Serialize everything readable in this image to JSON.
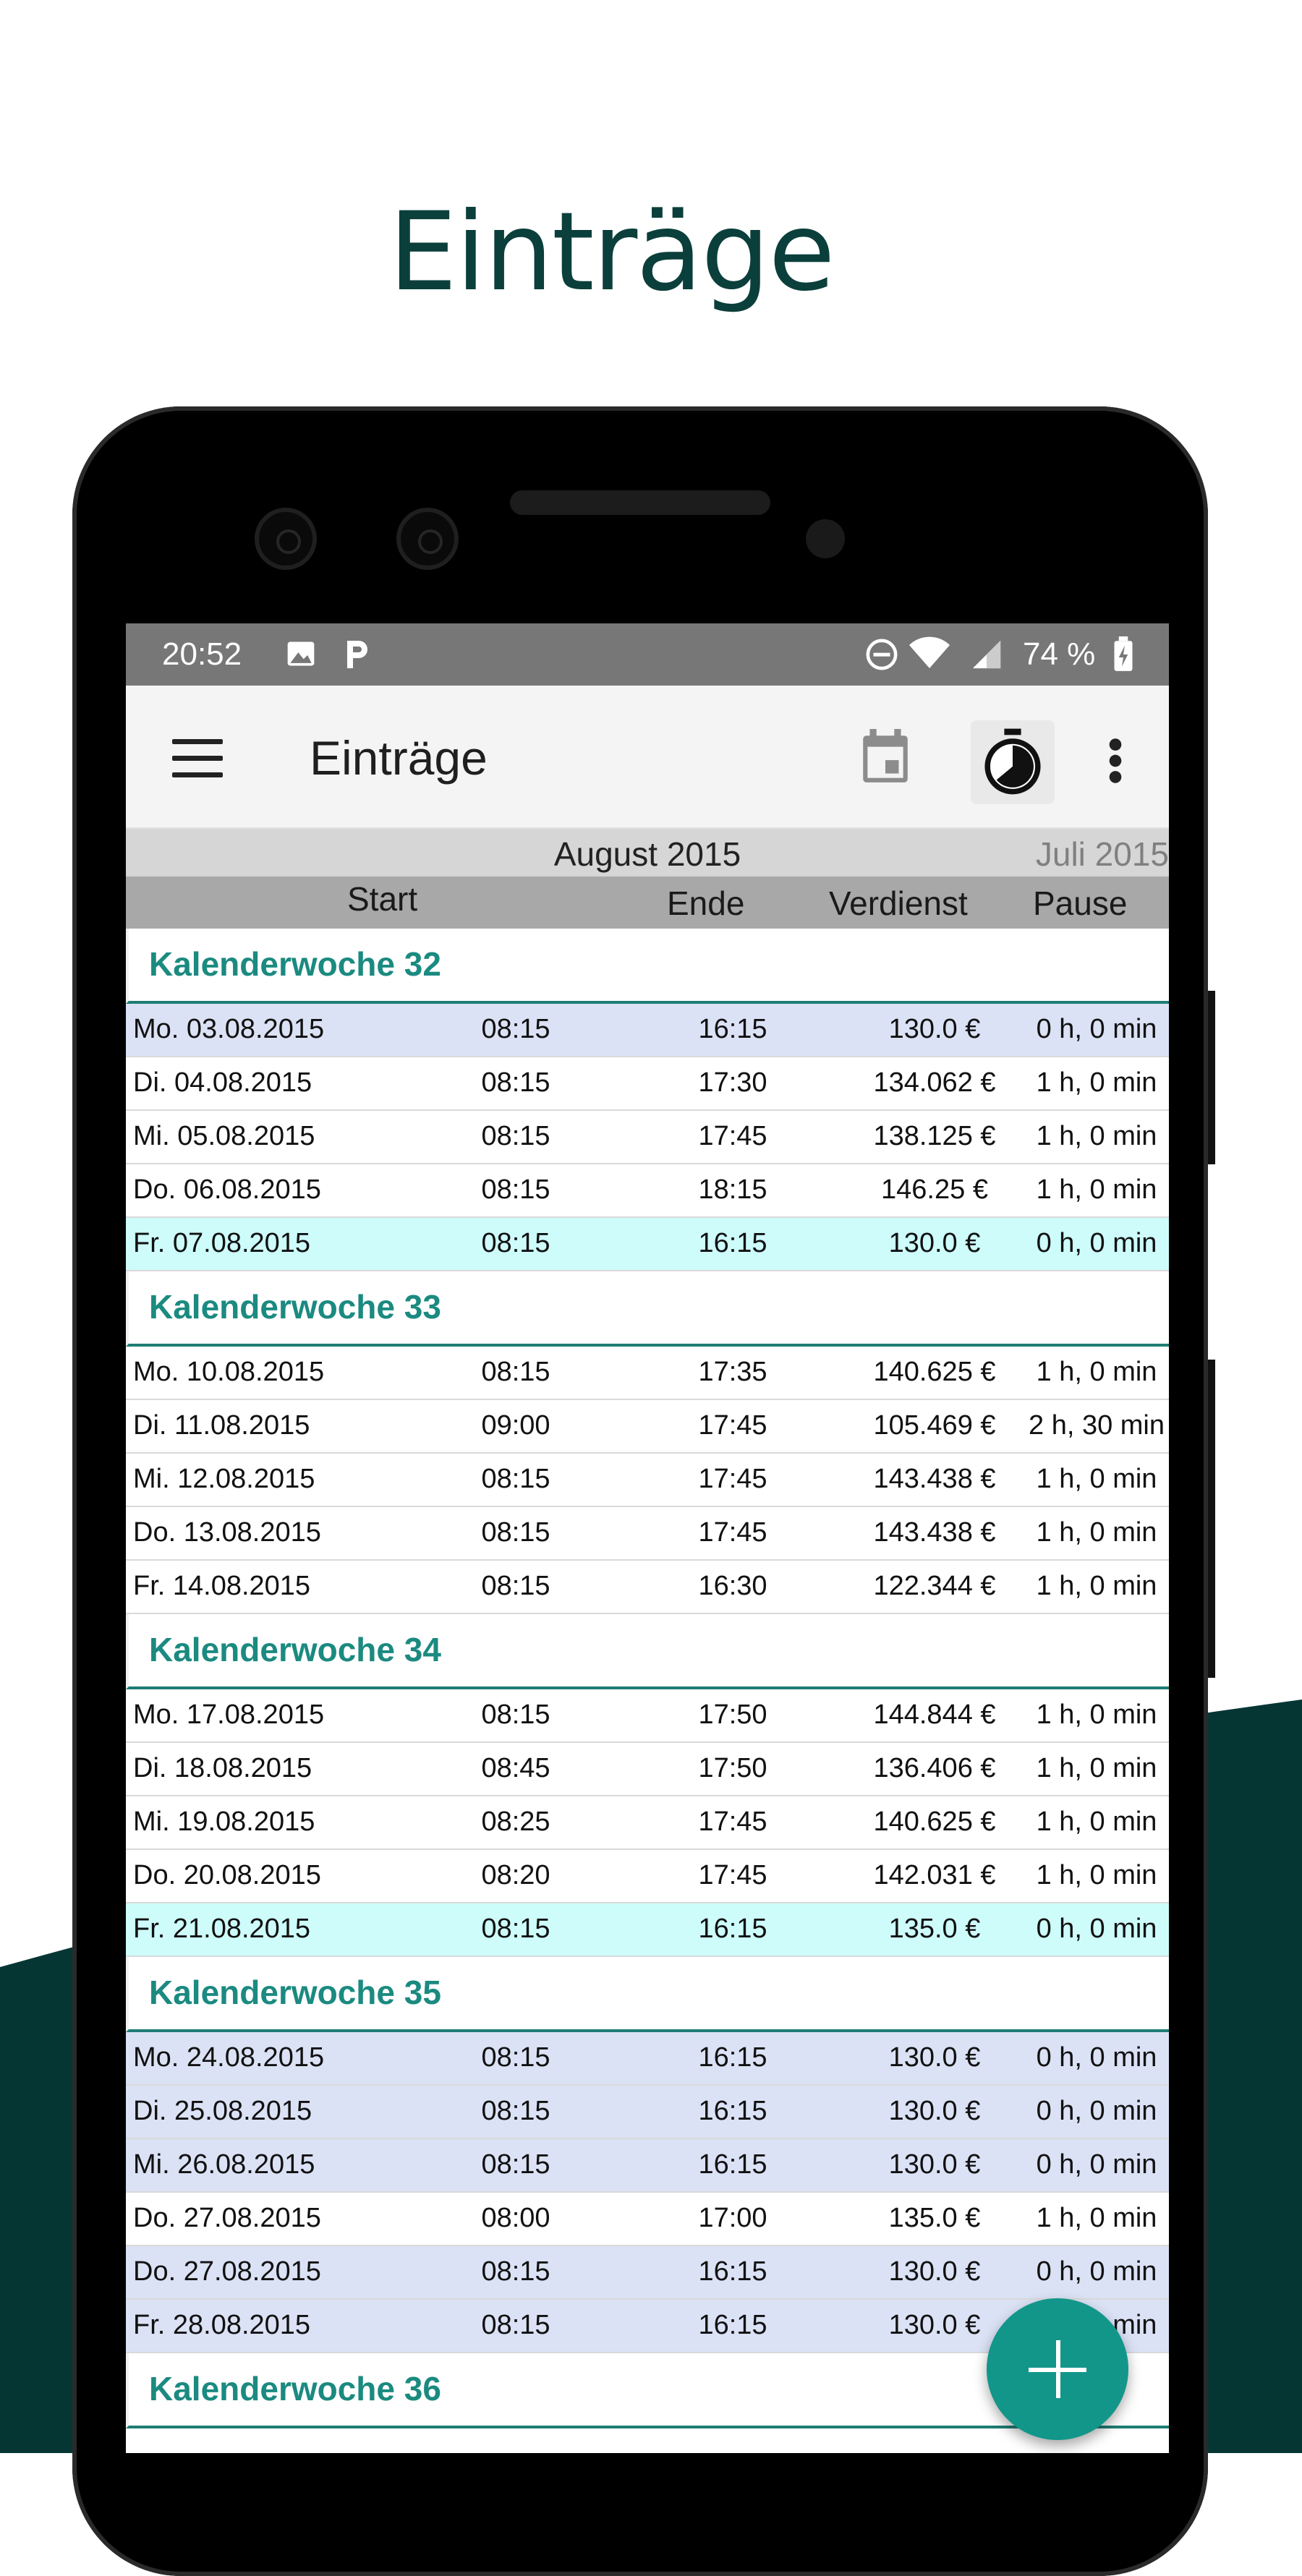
{
  "promo": {
    "title": "Einträge"
  },
  "colors": {
    "brand": "#0b3f3b",
    "accent": "#1b8a80",
    "fab": "#12968a",
    "row_blue": "#dbe2f5",
    "row_cyan": "#cdfcfb"
  },
  "status": {
    "time": "20:52",
    "battery": "74 %",
    "icons": [
      "image-icon",
      "parking-icon",
      "dnd-icon",
      "wifi-icon",
      "signal-icon",
      "battery-icon"
    ]
  },
  "appbar": {
    "title": "Einträge",
    "icons": [
      "menu-icon",
      "calendar-icon",
      "stopwatch-icon",
      "more-icon"
    ]
  },
  "month": {
    "current": "August 2015",
    "next": "Juli 2015"
  },
  "columns": {
    "start": "Start",
    "end": "Ende",
    "earnings": "Verdienst",
    "pause": "Pause"
  },
  "weeks": [
    {
      "label": "Kalenderwoche 32",
      "rows": [
        {
          "day": "Mo. 03.08.2015",
          "start": "08:15",
          "end": "16:15",
          "earnings": "130.0 €",
          "pause": "0 h, 0 min",
          "hl": "blue"
        },
        {
          "day": "Di. 04.08.2015",
          "start": "08:15",
          "end": "17:30",
          "earnings": "134.062 €",
          "pause": "1 h, 0 min",
          "hl": ""
        },
        {
          "day": "Mi. 05.08.2015",
          "start": "08:15",
          "end": "17:45",
          "earnings": "138.125 €",
          "pause": "1 h, 0 min",
          "hl": ""
        },
        {
          "day": "Do. 06.08.2015",
          "start": "08:15",
          "end": "18:15",
          "earnings": "146.25 €",
          "pause": "1 h, 0 min",
          "hl": ""
        },
        {
          "day": "Fr. 07.08.2015",
          "start": "08:15",
          "end": "16:15",
          "earnings": "130.0 €",
          "pause": "0 h, 0 min",
          "hl": "cyan"
        }
      ]
    },
    {
      "label": "Kalenderwoche 33",
      "rows": [
        {
          "day": "Mo. 10.08.2015",
          "start": "08:15",
          "end": "17:35",
          "earnings": "140.625 €",
          "pause": "1 h, 0 min",
          "hl": ""
        },
        {
          "day": "Di. 11.08.2015",
          "start": "09:00",
          "end": "17:45",
          "earnings": "105.469 €",
          "pause": "2 h, 30 min",
          "hl": ""
        },
        {
          "day": "Mi. 12.08.2015",
          "start": "08:15",
          "end": "17:45",
          "earnings": "143.438 €",
          "pause": "1 h, 0 min",
          "hl": ""
        },
        {
          "day": "Do. 13.08.2015",
          "start": "08:15",
          "end": "17:45",
          "earnings": "143.438 €",
          "pause": "1 h, 0 min",
          "hl": ""
        },
        {
          "day": "Fr. 14.08.2015",
          "start": "08:15",
          "end": "16:30",
          "earnings": "122.344 €",
          "pause": "1 h, 0 min",
          "hl": ""
        }
      ]
    },
    {
      "label": "Kalenderwoche 34",
      "rows": [
        {
          "day": "Mo. 17.08.2015",
          "start": "08:15",
          "end": "17:50",
          "earnings": "144.844 €",
          "pause": "1 h, 0 min",
          "hl": ""
        },
        {
          "day": "Di. 18.08.2015",
          "start": "08:45",
          "end": "17:50",
          "earnings": "136.406 €",
          "pause": "1 h, 0 min",
          "hl": ""
        },
        {
          "day": "Mi. 19.08.2015",
          "start": "08:25",
          "end": "17:45",
          "earnings": "140.625 €",
          "pause": "1 h, 0 min",
          "hl": ""
        },
        {
          "day": "Do. 20.08.2015",
          "start": "08:20",
          "end": "17:45",
          "earnings": "142.031 €",
          "pause": "1 h, 0 min",
          "hl": ""
        },
        {
          "day": "Fr. 21.08.2015",
          "start": "08:15",
          "end": "16:15",
          "earnings": "135.0 €",
          "pause": "0 h, 0 min",
          "hl": "cyan"
        }
      ]
    },
    {
      "label": "Kalenderwoche 35",
      "rows": [
        {
          "day": "Mo. 24.08.2015",
          "start": "08:15",
          "end": "16:15",
          "earnings": "130.0 €",
          "pause": "0 h, 0 min",
          "hl": "blue"
        },
        {
          "day": "Di. 25.08.2015",
          "start": "08:15",
          "end": "16:15",
          "earnings": "130.0 €",
          "pause": "0 h, 0 min",
          "hl": "blue"
        },
        {
          "day": "Mi. 26.08.2015",
          "start": "08:15",
          "end": "16:15",
          "earnings": "130.0 €",
          "pause": "0 h, 0 min",
          "hl": "blue"
        },
        {
          "day": "Do. 27.08.2015",
          "start": "08:00",
          "end": "17:00",
          "earnings": "135.0 €",
          "pause": "1 h, 0 min",
          "hl": ""
        },
        {
          "day": "Do. 27.08.2015",
          "start": "08:15",
          "end": "16:15",
          "earnings": "130.0 €",
          "pause": "0 h, 0 min",
          "hl": "blue"
        },
        {
          "day": "Fr. 28.08.2015",
          "start": "08:15",
          "end": "16:15",
          "earnings": "130.0 €",
          "pause": "0 h, 0 min",
          "hl": "blue"
        }
      ]
    },
    {
      "label": "Kalenderwoche 36",
      "rows": []
    }
  ]
}
